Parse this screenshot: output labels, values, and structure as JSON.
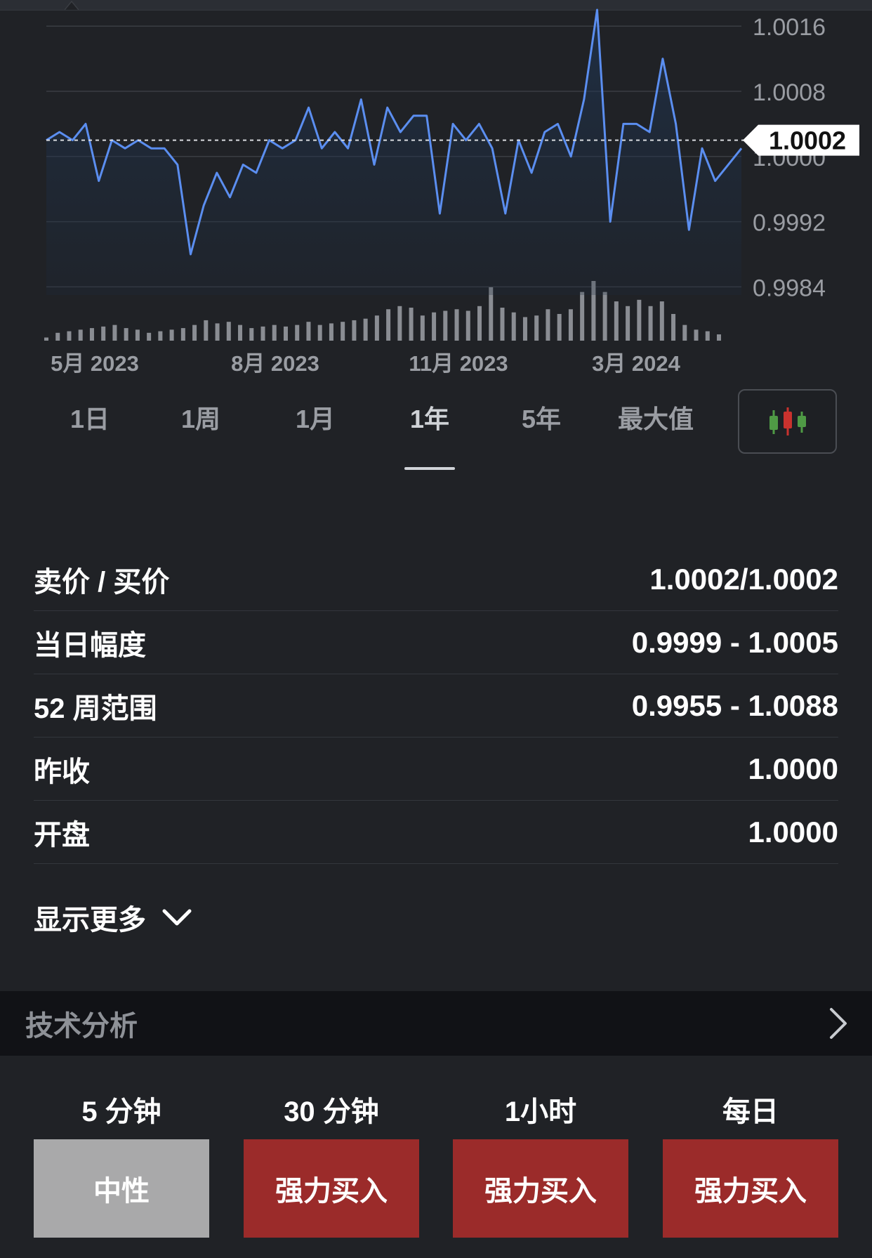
{
  "chart": {
    "current_price": "1.0002",
    "y_ticks": [
      "1.0016",
      "1.0008",
      "1.0000",
      "0.9992",
      "0.9984"
    ],
    "x_ticks": [
      "5月 2023",
      "8月 2023",
      "11月 2023",
      "3月 2024"
    ],
    "colors": {
      "line": "#5b8ef0",
      "volume": "#8a8d93",
      "background": "#202226"
    }
  },
  "chart_data": {
    "type": "line",
    "ylim": [
      0.9983,
      1.0018
    ],
    "y_ticks": [
      1.0016,
      1.0008,
      1.0,
      0.9992,
      0.9984
    ],
    "x_ticks": [
      "5月 2023",
      "8月 2023",
      "11月 2023",
      "3月 2024"
    ],
    "price_tag": 1.0002,
    "series": [
      {
        "values": [
          1.0002,
          1.0003,
          1.0002,
          1.0004,
          0.9997,
          1.0002,
          1.0001,
          1.0002,
          1.0001,
          1.0001,
          0.9999,
          0.9988,
          0.9994,
          0.9998,
          0.9995,
          0.9999,
          0.9998,
          1.0002,
          1.0001,
          1.0002,
          1.0006,
          1.0001,
          1.0003,
          1.0001,
          1.0007,
          0.9999,
          1.0006,
          1.0003,
          1.0005,
          1.0005,
          0.9993,
          1.0004,
          1.0002,
          1.0004,
          1.0001,
          0.9993,
          1.0002,
          0.9998,
          1.0003,
          1.0004,
          1.0,
          1.0007,
          1.0018,
          0.9992,
          1.0004,
          1.0004,
          1.0003,
          1.0012,
          1.0004,
          0.9991,
          1.0001,
          0.9997,
          0.9999,
          1.0001
        ]
      }
    ],
    "volume": [
      4,
      10,
      12,
      14,
      16,
      18,
      20,
      16,
      14,
      10,
      12,
      14,
      16,
      20,
      26,
      22,
      24,
      20,
      16,
      18,
      20,
      18,
      20,
      24,
      20,
      22,
      24,
      26,
      28,
      32,
      40,
      44,
      42,
      32,
      36,
      38,
      40,
      38,
      44,
      68,
      42,
      36,
      30,
      32,
      40,
      34,
      40,
      62,
      76,
      62,
      50,
      44,
      52,
      44,
      50,
      34,
      20,
      14,
      12,
      8
    ]
  },
  "ranges": [
    {
      "label": "1日",
      "active": false
    },
    {
      "label": "1周",
      "active": false
    },
    {
      "label": "1月",
      "active": false
    },
    {
      "label": "1年",
      "active": true
    },
    {
      "label": "5年",
      "active": false
    },
    {
      "label": "最大值",
      "active": false
    }
  ],
  "stats": [
    {
      "label": "卖价 / 买价",
      "value": "1.0002/1.0002"
    },
    {
      "label": "当日幅度",
      "value": "0.9999 - 1.0005"
    },
    {
      "label": "52 周范围",
      "value": "0.9955 - 1.0088"
    },
    {
      "label": "昨收",
      "value": "1.0000"
    },
    {
      "label": "开盘",
      "value": "1.0000"
    }
  ],
  "show_more": {
    "label": "显示更多",
    "icon": "chevron-down-icon"
  },
  "technical": {
    "title": "技术分析",
    "icon": "chevron-right-icon"
  },
  "signals": [
    {
      "period": "5 分钟",
      "signal": "中性",
      "type": "neutral",
      "color": "#a9a9aa"
    },
    {
      "period": "30 分钟",
      "signal": "强力买入",
      "type": "buy",
      "color": "#9b2b2a"
    },
    {
      "period": "1小时",
      "signal": "强力买入",
      "type": "buy",
      "color": "#9b2b2a"
    },
    {
      "period": "每日",
      "signal": "强力买入",
      "type": "buy",
      "color": "#9b2b2a"
    }
  ]
}
